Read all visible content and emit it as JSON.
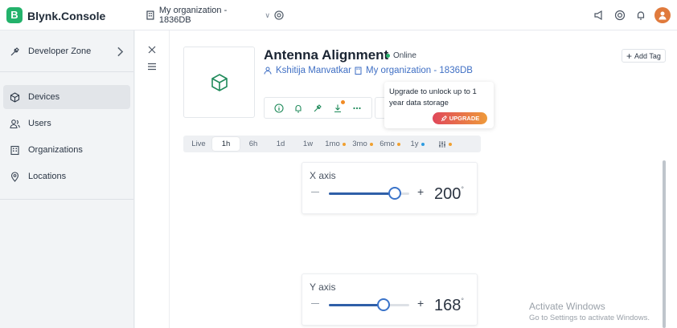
{
  "header": {
    "logo_letter": "B",
    "app_title": "Blynk.Console",
    "org_switcher": "My organization - 1836DB",
    "icons": [
      "building-icon",
      "chevron-down-icon",
      "settings-icon",
      "megaphone-icon",
      "help-lifebuoy-icon",
      "bell-icon",
      "user-avatar-icon"
    ]
  },
  "sidebar": {
    "items": [
      {
        "label": "Developer Zone",
        "icon": "tools-icon"
      },
      {
        "label": "Devices",
        "icon": "cube-icon"
      },
      {
        "label": "Users",
        "icon": "users-icon"
      },
      {
        "label": "Organizations",
        "icon": "building-icon"
      },
      {
        "label": "Locations",
        "icon": "map-pin-icon"
      }
    ]
  },
  "device": {
    "name": "Antenna Alignment",
    "status": "Online",
    "owner": "Kshitija Manvatkar",
    "organization": "My organization - 1836DB",
    "add_tag": "Add Tag"
  },
  "popup": {
    "text": "Upgrade to unlock up to 1 year data storage",
    "button": "UPGRADE"
  },
  "time_tabs": [
    {
      "label": "Live",
      "dot": ""
    },
    {
      "label": "1h",
      "dot": "",
      "active": true
    },
    {
      "label": "6h",
      "dot": ""
    },
    {
      "label": "1d",
      "dot": ""
    },
    {
      "label": "1w",
      "dot": ""
    },
    {
      "label": "1mo",
      "dot": "#f0a030"
    },
    {
      "label": "3mo",
      "dot": "#f0a030"
    },
    {
      "label": "6mo",
      "dot": "#f0a030"
    },
    {
      "label": "1y",
      "dot": "#2e9be0"
    },
    {
      "label": "",
      "dot": "#f0a030",
      "icon": "sliders-icon"
    }
  ],
  "widgets": [
    {
      "title": "X axis",
      "value": "200",
      "unit": "°",
      "fraction": 0.82
    },
    {
      "title": "Y axis",
      "value": "168",
      "unit": "°",
      "fraction": 0.68
    }
  ],
  "watermark": {
    "line1": "Activate Windows",
    "line2": "Go to Settings to activate Windows."
  },
  "colors": {
    "brand": "#23b26b",
    "link": "#3f6fc4",
    "online": "#27b06b",
    "slider": "#3a73c9"
  }
}
